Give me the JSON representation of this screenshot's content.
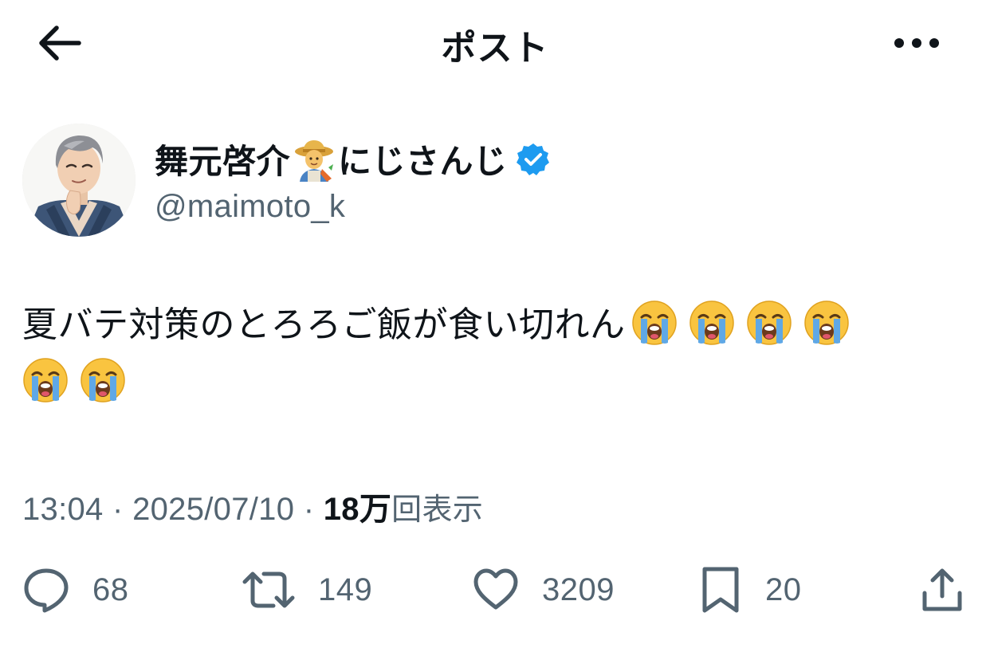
{
  "header": {
    "title": "ポスト",
    "back_icon": "back-arrow-icon",
    "more_icon": "more-dots-icon"
  },
  "author": {
    "display_name_part1": "舞元啓介",
    "name_emoji": "farmer-emoji",
    "display_name_part2": "にじさんじ",
    "handle": "@maimoto_k",
    "verified": true,
    "verified_color": "#1d9bf0"
  },
  "post": {
    "text": "夏バテ対策のとろろご飯が食い切れん",
    "emoji": "loudly-crying-face",
    "emoji_count": 6
  },
  "meta": {
    "time": "13:04",
    "separator": "·",
    "date": "2025/07/10",
    "views_count": "18万",
    "views_label": "回表示"
  },
  "actions": {
    "replies": "68",
    "reposts": "149",
    "likes": "3209",
    "bookmarks": "20"
  },
  "colors": {
    "text": "#0f1419",
    "secondary": "#536471",
    "accent": "#1d9bf0"
  }
}
